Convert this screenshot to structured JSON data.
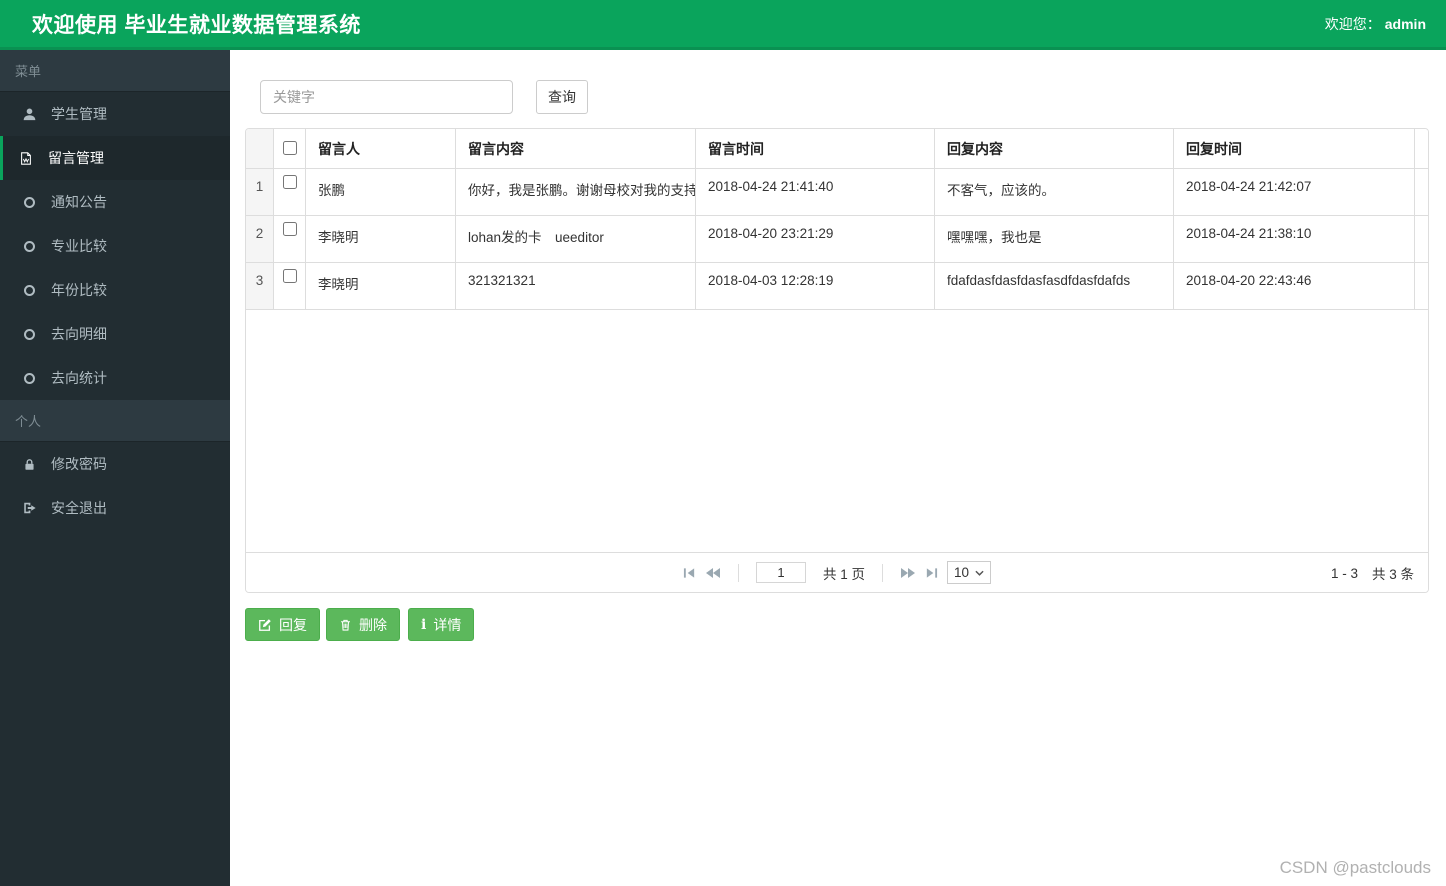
{
  "topbar": {
    "title": "欢迎使用 毕业生就业数据管理系统",
    "welcome_label": "欢迎您：",
    "username": "admin"
  },
  "sidebar": {
    "sections": [
      {
        "header": "菜单",
        "items": [
          {
            "label": "学生管理",
            "icon": "user-icon",
            "active": false
          },
          {
            "label": "留言管理",
            "icon": "message-file-icon",
            "active": true
          },
          {
            "label": "通知公告",
            "icon": "circle-icon",
            "active": false
          },
          {
            "label": "专业比较",
            "icon": "circle-icon",
            "active": false
          },
          {
            "label": "年份比较",
            "icon": "circle-icon",
            "active": false
          },
          {
            "label": "去向明细",
            "icon": "circle-icon",
            "active": false
          },
          {
            "label": "去向统计",
            "icon": "circle-icon",
            "active": false
          }
        ]
      },
      {
        "header": "个人",
        "items": [
          {
            "label": "修改密码",
            "icon": "lock-icon",
            "active": false
          },
          {
            "label": "安全退出",
            "icon": "sign-out-icon",
            "active": false
          }
        ]
      }
    ]
  },
  "search": {
    "placeholder": "关键字",
    "button_label": "查询"
  },
  "table": {
    "columns": [
      "留言人",
      "留言内容",
      "留言时间",
      "回复内容",
      "回复时间"
    ],
    "rows": [
      {
        "index": "1",
        "name": "张鹏",
        "content": "你好，我是张鹏。谢谢母校对我的支持",
        "time": "2018-04-24 21:41:40",
        "reply": "不客气，应该的。",
        "reply_time": "2018-04-24 21:42:07"
      },
      {
        "index": "2",
        "name": "李晓明",
        "content": "lohan发的卡　ueeditor",
        "time": "2018-04-20 23:21:29",
        "reply": "嘿嘿嘿，我也是",
        "reply_time": "2018-04-24 21:38:10"
      },
      {
        "index": "3",
        "name": "李晓明",
        "content": "321321321",
        "time": "2018-04-03 12:28:19",
        "reply": "fdafdasfdasfdasfasdfdasfdafds",
        "reply_time": "2018-04-20 22:43:46"
      }
    ]
  },
  "pager": {
    "page_value": "1",
    "total_pages_label": "共 1 页",
    "page_size": "10",
    "range_label": "1 - 3",
    "total_label": "共 3 条"
  },
  "actions": {
    "reply_label": "回复",
    "delete_label": "删除",
    "detail_label": "详情"
  },
  "watermark": "CSDN @pastclouds",
  "colors": {
    "header_green": "#0aa45c",
    "button_green": "#5cb85c",
    "sidebar_bg": "#222d32",
    "active_item_bg": "#1e282c",
    "border_gray": "#dddddd"
  }
}
